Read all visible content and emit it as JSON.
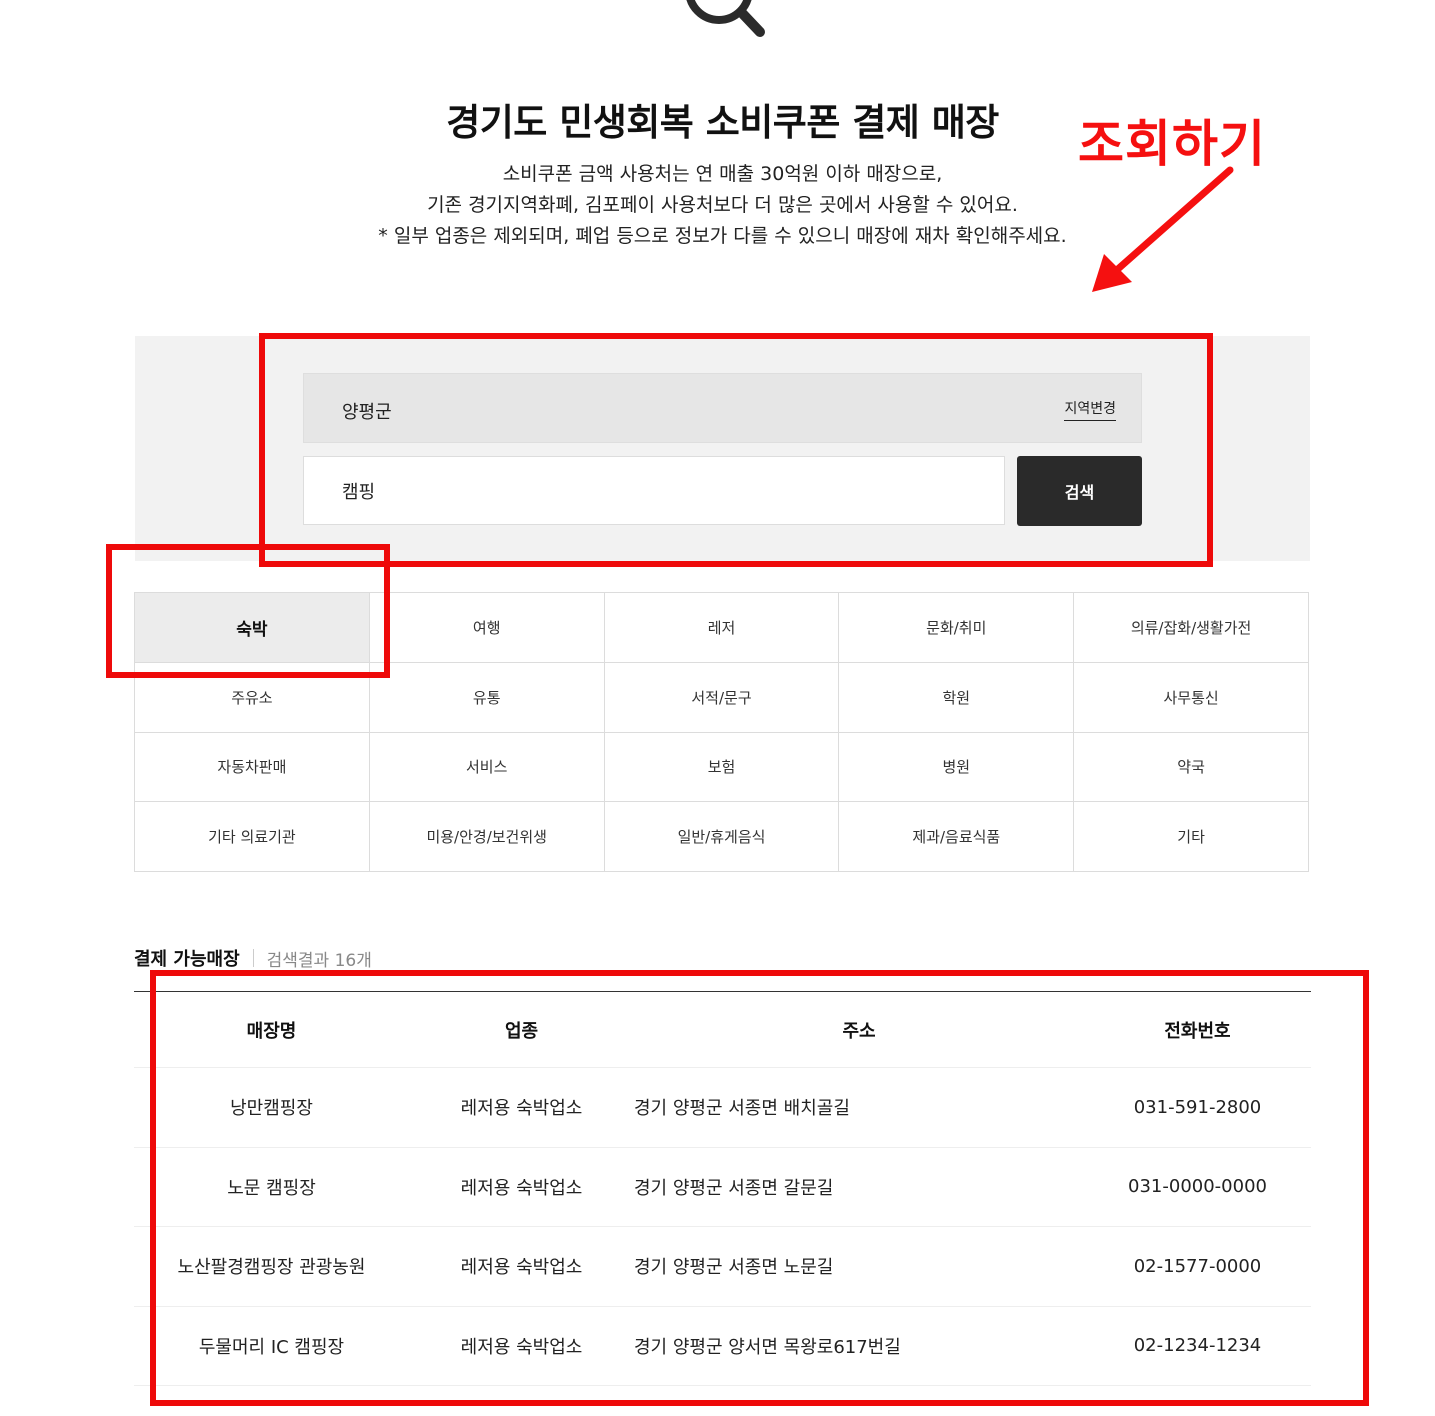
{
  "header": {
    "title": "경기도 민생회복 소비쿠폰 결제 매장",
    "description_lines": [
      "소비쿠폰 금액 사용처는 연 매출 30억원 이하 매장으로,",
      "기존 경기지역화폐, 김포페이 사용처보다 더 많은 곳에서 사용할 수 있어요.",
      "* 일부 업종은 제외되며, 폐업 등으로 정보가 다를 수 있으니 매장에 재차 확인해주세요."
    ]
  },
  "annotation": {
    "label": "조회하기",
    "color": "#f51010"
  },
  "search": {
    "region": "양평군",
    "region_change_label": "지역변경",
    "keyword": "캠핑",
    "button_label": "검색"
  },
  "categories": {
    "active": "숙박",
    "items": [
      "숙박",
      "여행",
      "레저",
      "문화/취미",
      "의류/잡화/생활가전",
      "주유소",
      "유통",
      "서적/문구",
      "학원",
      "사무통신",
      "자동차판매",
      "서비스",
      "보험",
      "병원",
      "약국",
      "기타 의료기관",
      "미용/안경/보건위생",
      "일반/휴게음식",
      "제과/음료식품",
      "기타"
    ]
  },
  "results": {
    "title": "결제 가능매장",
    "count_label": "검색결과 16개",
    "columns": [
      "매장명",
      "업종",
      "주소",
      "전화번호"
    ],
    "rows": [
      [
        "낭만캠핑장",
        "레저용 숙박업소",
        "경기 양평군 서종면 배치골길",
        "031-591-2800"
      ],
      [
        "노문 캠핑장",
        "레저용 숙박업소",
        "경기 양평군 서종면 갈문길",
        "031-0000-0000"
      ],
      [
        "노산팔경캠핑장 관광농원",
        "레저용 숙박업소",
        "경기 양평군 서종면 노문길",
        "02-1577-0000"
      ],
      [
        "두물머리 IC 캠핑장",
        "레저용 숙박업소",
        "경기 양평군 양서면 목왕로617번길",
        "02-1234-1234"
      ]
    ]
  },
  "colors": {
    "highlight": "#ee0a0a",
    "search_button": "#2a2a2a",
    "panel_bg": "#f2f2f2"
  },
  "icons": {
    "top": "magnifier-icon"
  }
}
